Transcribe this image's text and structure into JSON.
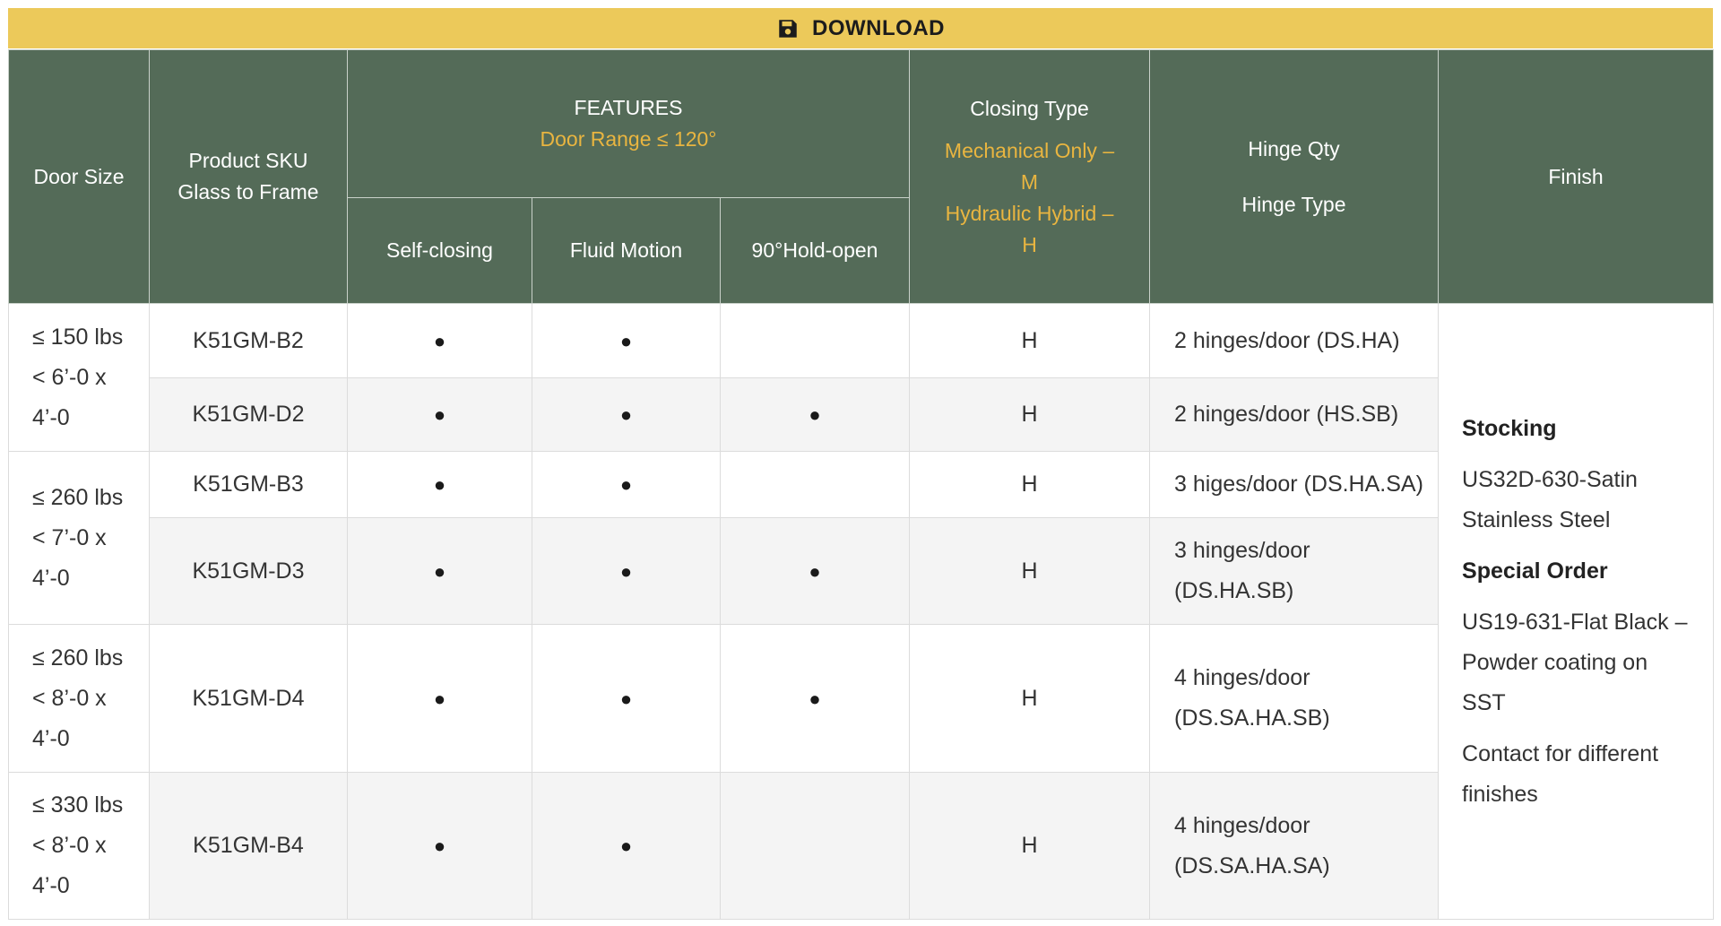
{
  "download": {
    "label": "DOWNLOAD",
    "icon": "floppy-disk-icon"
  },
  "header": {
    "door_size": "Door Size",
    "sku_line1": "Product SKU",
    "sku_line2": "Glass to Frame",
    "features": "FEATURES",
    "door_range": "Door Range ≤ 120°",
    "self_closing": "Self-closing",
    "fluid_motion": "Fluid Motion",
    "hold_open": "90°Hold-open",
    "closing_type": "Closing Type",
    "mech_line1": "Mechanical Only –",
    "mech_line2": "M",
    "hyd_line1": "Hydraulic Hybrid –",
    "hyd_line2": "H",
    "hinge_qty": "Hinge Qty",
    "hinge_type": "Hinge Type",
    "finish": "Finish"
  },
  "sizes": [
    {
      "weight": "≤ 150 lbs",
      "dim1": "< 6’-0 x",
      "dim2": "4’-0"
    },
    {
      "weight": "≤ 260 lbs",
      "dim1": "< 7’-0 x",
      "dim2": "4’-0"
    },
    {
      "weight": "≤ 260 lbs",
      "dim1": "< 8’-0 x",
      "dim2": "4’-0"
    },
    {
      "weight": "≤ 330 lbs",
      "dim1": "< 8’-0 x",
      "dim2": "4’-0"
    }
  ],
  "rows": [
    {
      "sku": "K51GM-B2",
      "self_closing": "●",
      "fluid_motion": "●",
      "hold_open": "",
      "closing": "H",
      "hinge1": "2 hinges/door (DS.HA)",
      "hinge2": ""
    },
    {
      "sku": "K51GM-D2",
      "self_closing": "●",
      "fluid_motion": "●",
      "hold_open": "●",
      "closing": "H",
      "hinge1": "2 hinges/door (HS.SB)",
      "hinge2": ""
    },
    {
      "sku": "K51GM-B3",
      "self_closing": "●",
      "fluid_motion": "●",
      "hold_open": "",
      "closing": "H",
      "hinge1": "3 higes/door (DS.HA.SA)",
      "hinge2": ""
    },
    {
      "sku": "K51GM-D3",
      "self_closing": "●",
      "fluid_motion": "●",
      "hold_open": "●",
      "closing": "H",
      "hinge1": "3 hinges/door",
      "hinge2": "(DS.HA.SB)"
    },
    {
      "sku": "K51GM-D4",
      "self_closing": "●",
      "fluid_motion": "●",
      "hold_open": "●",
      "closing": "H",
      "hinge1": "4 hinges/door",
      "hinge2": "(DS.SA.HA.SB)"
    },
    {
      "sku": "K51GM-B4",
      "self_closing": "●",
      "fluid_motion": "●",
      "hold_open": "",
      "closing": "H",
      "hinge1": "4 hinges/door",
      "hinge2": "(DS.SA.HA.SA)"
    }
  ],
  "finish": {
    "stocking_title": "Stocking",
    "stocking_line1": "US32D-630-Satin",
    "stocking_line2": "Stainless Steel",
    "special_title": "Special Order",
    "special_line1": "US19-631-Flat Black –",
    "special_line2": "Powder coating on SST",
    "contact_line1": "Contact for different",
    "contact_line2": "finishes"
  },
  "colors": {
    "header_bg": "#546b58",
    "accent_gold": "#e9b540",
    "download_bg": "#ecc95a"
  }
}
